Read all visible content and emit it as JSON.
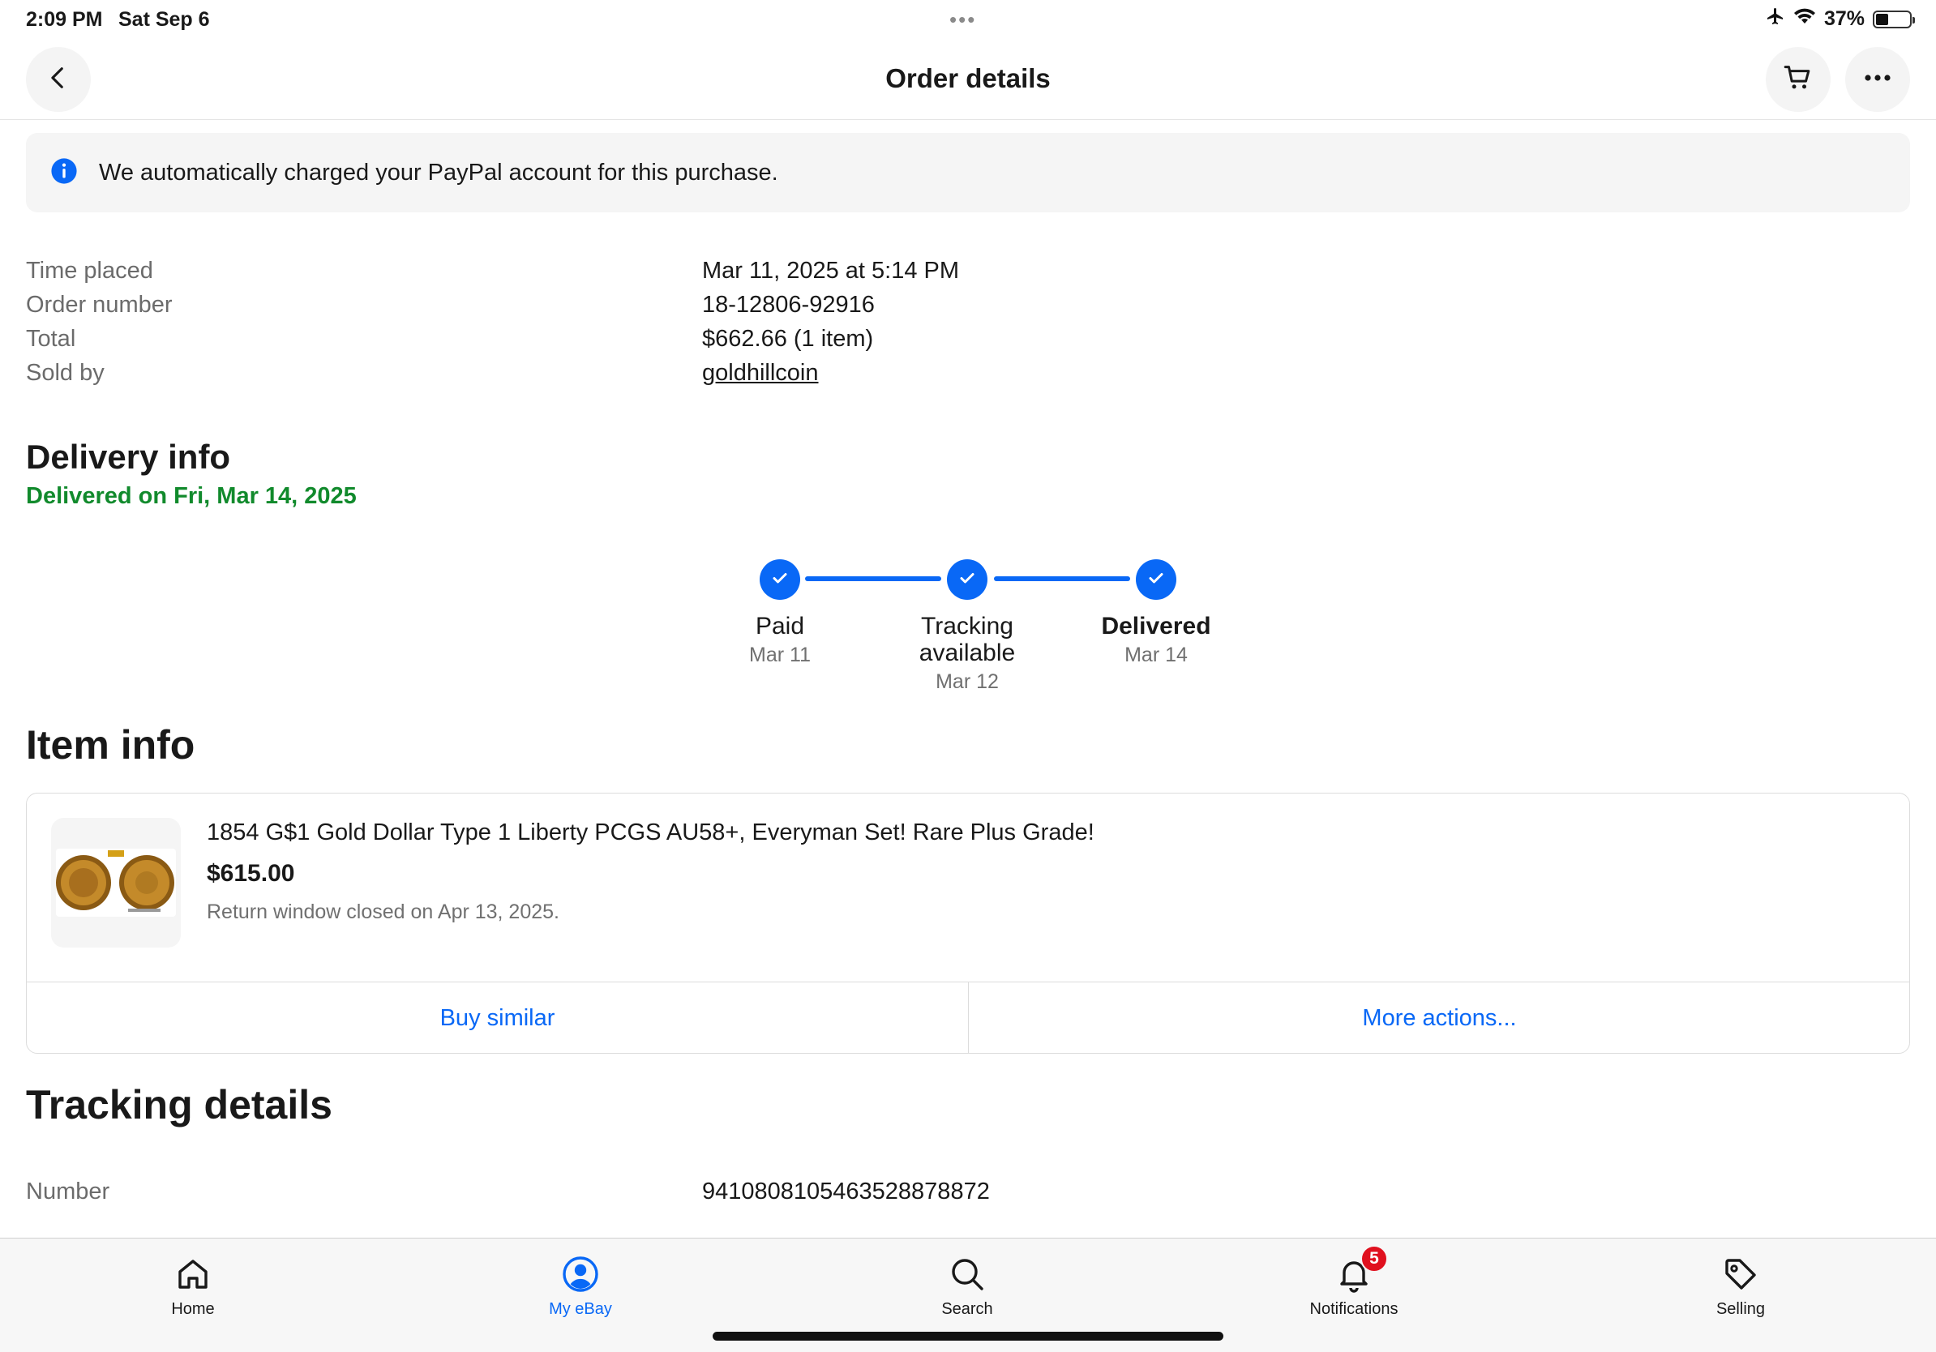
{
  "status_bar": {
    "time": "2:09 PM",
    "date": "Sat Sep 6",
    "dots": "•••",
    "battery": "37%",
    "battery_level": 0.37
  },
  "header": {
    "title": "Order details",
    "back_icon": "chevron-left-icon",
    "cart_icon": "cart-icon",
    "more_icon": "more-horizontal-icon"
  },
  "banner": {
    "text": "We automatically charged your PayPal account for this purchase.",
    "icon": "info-icon"
  },
  "order": {
    "time_label": "Time placed",
    "time_value": "Mar 11, 2025 at 5:14 PM",
    "number_label": "Order number",
    "number_value": "18-12806-92916",
    "total_label": "Total",
    "total_value": "$662.66 (1 item)",
    "seller_label": "Sold by",
    "seller_value": "goldhillcoin"
  },
  "delivery": {
    "title": "Delivery info",
    "status": "Delivered on Fri, Mar 14, 2025",
    "steps": [
      {
        "line1": "Paid",
        "line2": "",
        "date": "Mar 11"
      },
      {
        "line1": "Tracking",
        "line2": "available",
        "date": "Mar 12"
      },
      {
        "line1": "Delivered",
        "line2": "",
        "date": "Mar 14"
      }
    ]
  },
  "item": {
    "section_title": "Item info",
    "title": "1854 G$1 Gold Dollar Type 1 Liberty PCGS AU58+, Everyman Set! Rare Plus Grade!",
    "price": "$615.00",
    "return_note": "Return window closed on Apr 13, 2025.",
    "buy_similar": "Buy similar",
    "more_actions": "More actions..."
  },
  "tracking": {
    "title": "Tracking details",
    "number_label": "Number",
    "number_value": "9410808105463528878872"
  },
  "tabs": [
    {
      "label": "Home",
      "icon": "home-icon"
    },
    {
      "label": "My eBay",
      "icon": "user-circle-icon",
      "active": true
    },
    {
      "label": "Search",
      "icon": "search-icon"
    },
    {
      "label": "Notifications",
      "icon": "bell-icon",
      "badge": "5"
    },
    {
      "label": "Selling",
      "icon": "tag-icon"
    }
  ],
  "colors": {
    "accent": "#0968f6",
    "success": "#118a2c",
    "badge": "#e0101e"
  }
}
